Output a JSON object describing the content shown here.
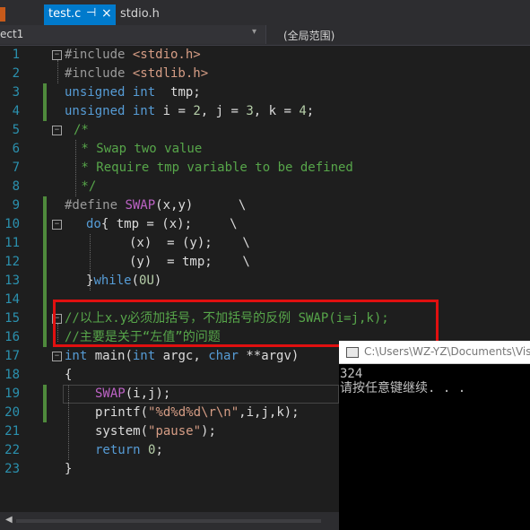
{
  "tabs": {
    "active": {
      "label": "test.c",
      "pin": "⊣",
      "close": "×"
    },
    "other": {
      "label": "stdio.h"
    }
  },
  "nav": {
    "project": "ect1",
    "dropdown_arrow": "▾",
    "scope": "(全局范围)"
  },
  "editor": {
    "line_numbers": [
      "1",
      "2",
      "3",
      "4",
      "5",
      "6",
      "7",
      "8",
      "9",
      "10",
      "11",
      "12",
      "13",
      "14",
      "15",
      "16",
      "17",
      "18",
      "19",
      "20",
      "21",
      "22",
      "23"
    ],
    "lines": {
      "l1_pre": "#include ",
      "l1_inc": "<stdio.h>",
      "l2_pre": "#include ",
      "l2_inc": "<stdlib.h>",
      "l3_kw": "unsigned int",
      "l3_rest": "  tmp;",
      "l4_kw1": "unsigned int",
      "l4_rest": " i = ",
      "l4_n1": "2",
      "l4_mid1": ", j = ",
      "l4_n2": "3",
      "l4_mid2": ", k = ",
      "l4_n3": "4",
      "l4_end": ";",
      "l5": "/*",
      "l6": " * Swap two value",
      "l7": " * Require tmp variable to be defined",
      "l8": " */",
      "l9_pre": "#define ",
      "l9_mac": "SWAP",
      "l9_rest": "(x,y)      \\",
      "l10_kw": "do",
      "l10_rest": "{ tmp = (x);     \\",
      "l11": "(x)  = (y);    \\",
      "l12": "(y)  = tmp;    \\",
      "l13_brace": "}",
      "l13_kw": "while",
      "l13_rest": "(",
      "l13_num": "0U",
      "l13_end": ")",
      "l15": "//以上x.y必须加括号，不加括号的反例 SWAP(i=j,k);",
      "l16": "//主要是关于“左值”的问题",
      "l17_kw1": "int",
      "l17_name": " main(",
      "l17_kw2": "int",
      "l17_argc": " argc, ",
      "l17_kw3": "char",
      "l17_rest": " **argv)",
      "l18": "{",
      "l19_mac": "SWAP",
      "l19_rest": "(i,j);",
      "l20_fn": "printf(",
      "l20_str": "\"%d%d%d\\r\\n\"",
      "l20_rest": ",i,j,k);",
      "l21_fn": "system(",
      "l21_str": "\"pause\"",
      "l21_rest": ");",
      "l22_kw": "return",
      "l22_sp": " ",
      "l22_num": "0",
      "l22_end": ";",
      "l23": "}"
    }
  },
  "console": {
    "title": "C:\\Users\\WZ-YZ\\Documents\\Vis",
    "output_line1": "324",
    "output_line2": "请按任意键继续. . ."
  },
  "status": {
    "scroll_left": "◀"
  },
  "colors": {
    "keyword": "#569cd6",
    "comment": "#57a64a",
    "string": "#d69d85",
    "macro": "#bd63c5",
    "line_number": "#2b91af",
    "active_tab": "#007acc",
    "annotation": "#e01010"
  }
}
